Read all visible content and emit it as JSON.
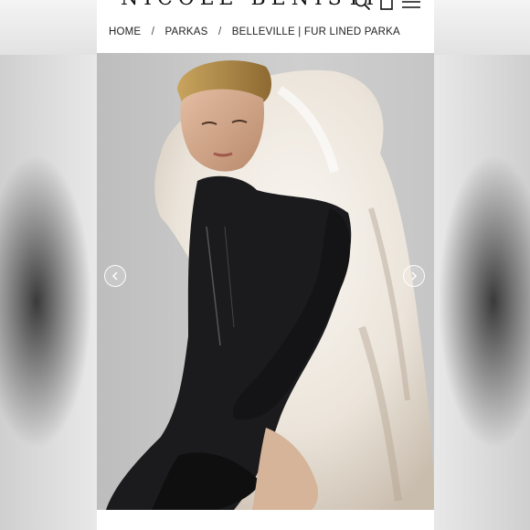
{
  "brand": {
    "logo_text": "NICOLE BENISTI"
  },
  "header": {
    "search_icon": "search-icon",
    "bag_icon": "shopping-bag-icon",
    "menu_icon": "hamburger-menu-icon"
  },
  "breadcrumb": {
    "items": [
      "HOME",
      "PARKAS",
      "BELLEVILLE | FUR LINED PARKA"
    ],
    "separator": "/"
  },
  "carousel": {
    "prev_icon": "chevron-left-icon",
    "next_icon": "chevron-right-icon"
  },
  "colors": {
    "fur": "#efe9e1",
    "jacket": "#1b1b1d",
    "backdrop": "#c4c4c4"
  }
}
